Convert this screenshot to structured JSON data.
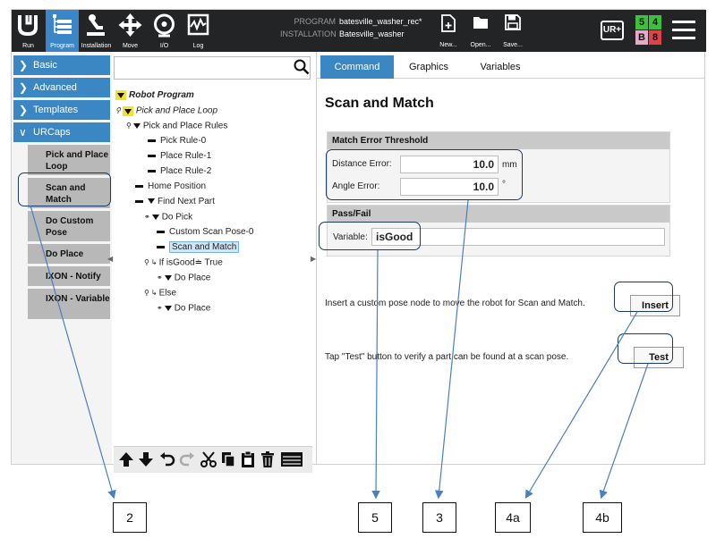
{
  "topbar": {
    "nav": [
      {
        "label": "Run",
        "icon": "ur-logo-icon"
      },
      {
        "label": "Program",
        "icon": "program-icon"
      },
      {
        "label": "Installation",
        "icon": "installation-icon"
      },
      {
        "label": "Move",
        "icon": "move-icon"
      },
      {
        "label": "I/O",
        "icon": "io-icon"
      },
      {
        "label": "Log",
        "icon": "log-icon"
      }
    ],
    "program_key": "PROGRAM",
    "program_value": "batesville_washer_rec*",
    "installation_key": "INSTALLATION",
    "installation_value": "Batesville_washer",
    "new_label": "New...",
    "open_label": "Open...",
    "save_label": "Save...",
    "urplus_label": "UR+",
    "io_status": [
      "5",
      "4",
      "B",
      "8"
    ],
    "colors": {
      "green": "#3fbf3f",
      "pink": "#e8a9c9",
      "red": "#e0414b",
      "accent": "#3b87c4"
    }
  },
  "sidebar": {
    "categories": [
      "Basic",
      "Advanced",
      "Templates",
      "URCaps"
    ],
    "urcaps_items": [
      "Pick and Place Loop",
      "Scan and Match",
      "Do Custom Pose",
      "Do Place",
      "IXON - Notify",
      "IXON - Variable"
    ]
  },
  "tree": {
    "search_value": "",
    "rows": [
      "Robot Program",
      "Pick and Place Loop",
      "Pick and Place Rules",
      "Pick Rule-0",
      "Place Rule-1",
      "Place Rule-2",
      "Home Position",
      "Find Next Part",
      "Do Pick",
      "Custom Scan Pose-0",
      "Scan and Match",
      "If isGood≐ True",
      "Do Place",
      "Else",
      "Do Place"
    ]
  },
  "content": {
    "tabs": [
      "Command",
      "Graphics",
      "Variables"
    ],
    "title": "Scan and Match",
    "threshold_header": "Match Error Threshold",
    "distance_label": "Distance Error:",
    "distance_value": "10.0",
    "distance_unit": "mm",
    "angle_label": "Angle Error:",
    "angle_value": "10.0",
    "angle_unit": "°",
    "passfail_header": "Pass/Fail",
    "variable_label": "Variable:",
    "variable_value": "isGood",
    "insert_hint": "Insert a custom pose node to move the robot for Scan and Match.",
    "insert_label": "Insert",
    "test_hint": "Tap \"Test\" button to verify a part can be found at a scan pose.",
    "test_label": "Test"
  },
  "callouts": [
    "2",
    "5",
    "3",
    "4a",
    "4b"
  ]
}
